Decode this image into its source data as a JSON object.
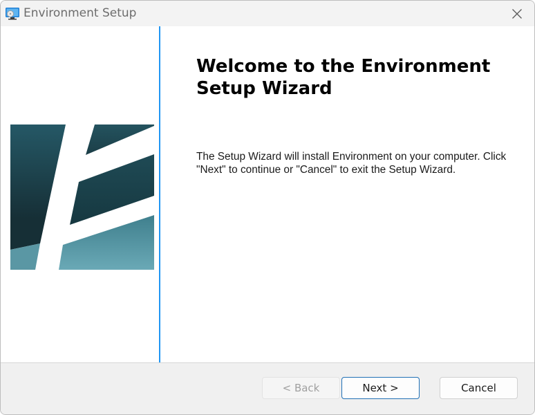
{
  "window": {
    "title": "Environment Setup"
  },
  "icons": {
    "app": "installer-monitor-icon",
    "close": "close-icon",
    "logo": "environment-logo"
  },
  "wizard": {
    "heading": "Welcome to the Environment Setup Wizard",
    "description": "The Setup Wizard will install Environment on your computer. Click \"Next\" to continue or \"Cancel\" to exit the Setup Wizard."
  },
  "buttons": {
    "back": "< Back",
    "next": "Next >",
    "cancel": "Cancel"
  },
  "colors": {
    "accent_divider": "#2196f3",
    "logo_dark": "#1d4a55",
    "logo_light": "#5e9fae",
    "default_button_border": "#1f6fb5"
  }
}
